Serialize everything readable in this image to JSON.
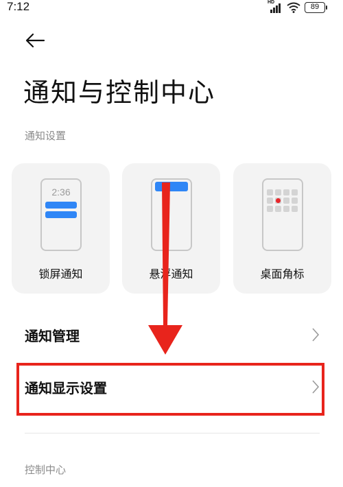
{
  "status_bar": {
    "time": "7:12",
    "network_label": "HD",
    "battery": "89"
  },
  "page": {
    "title": "通知与控制中心"
  },
  "sections": {
    "notification_settings": "通知设置",
    "control_center": "控制中心"
  },
  "notification_modes": [
    {
      "label": "锁屏通知",
      "preview_time": "2:36",
      "icon": "lockscreen-preview-icon"
    },
    {
      "label": "悬浮通知",
      "icon": "floating-banner-preview-icon"
    },
    {
      "label": "桌面角标",
      "icon": "desktop-badge-preview-icon"
    }
  ],
  "list_items": [
    {
      "label": "通知管理",
      "icon": "chevron-right-icon"
    },
    {
      "label": "通知显示设置",
      "icon": "chevron-right-icon",
      "highlighted": true
    }
  ],
  "colors": {
    "accent_blue": "#2f86f6",
    "annotation_red": "#e8241c",
    "badge_red": "#e8262a",
    "card_background": "#f3f3f3",
    "secondary_text": "#8a8a8a"
  }
}
